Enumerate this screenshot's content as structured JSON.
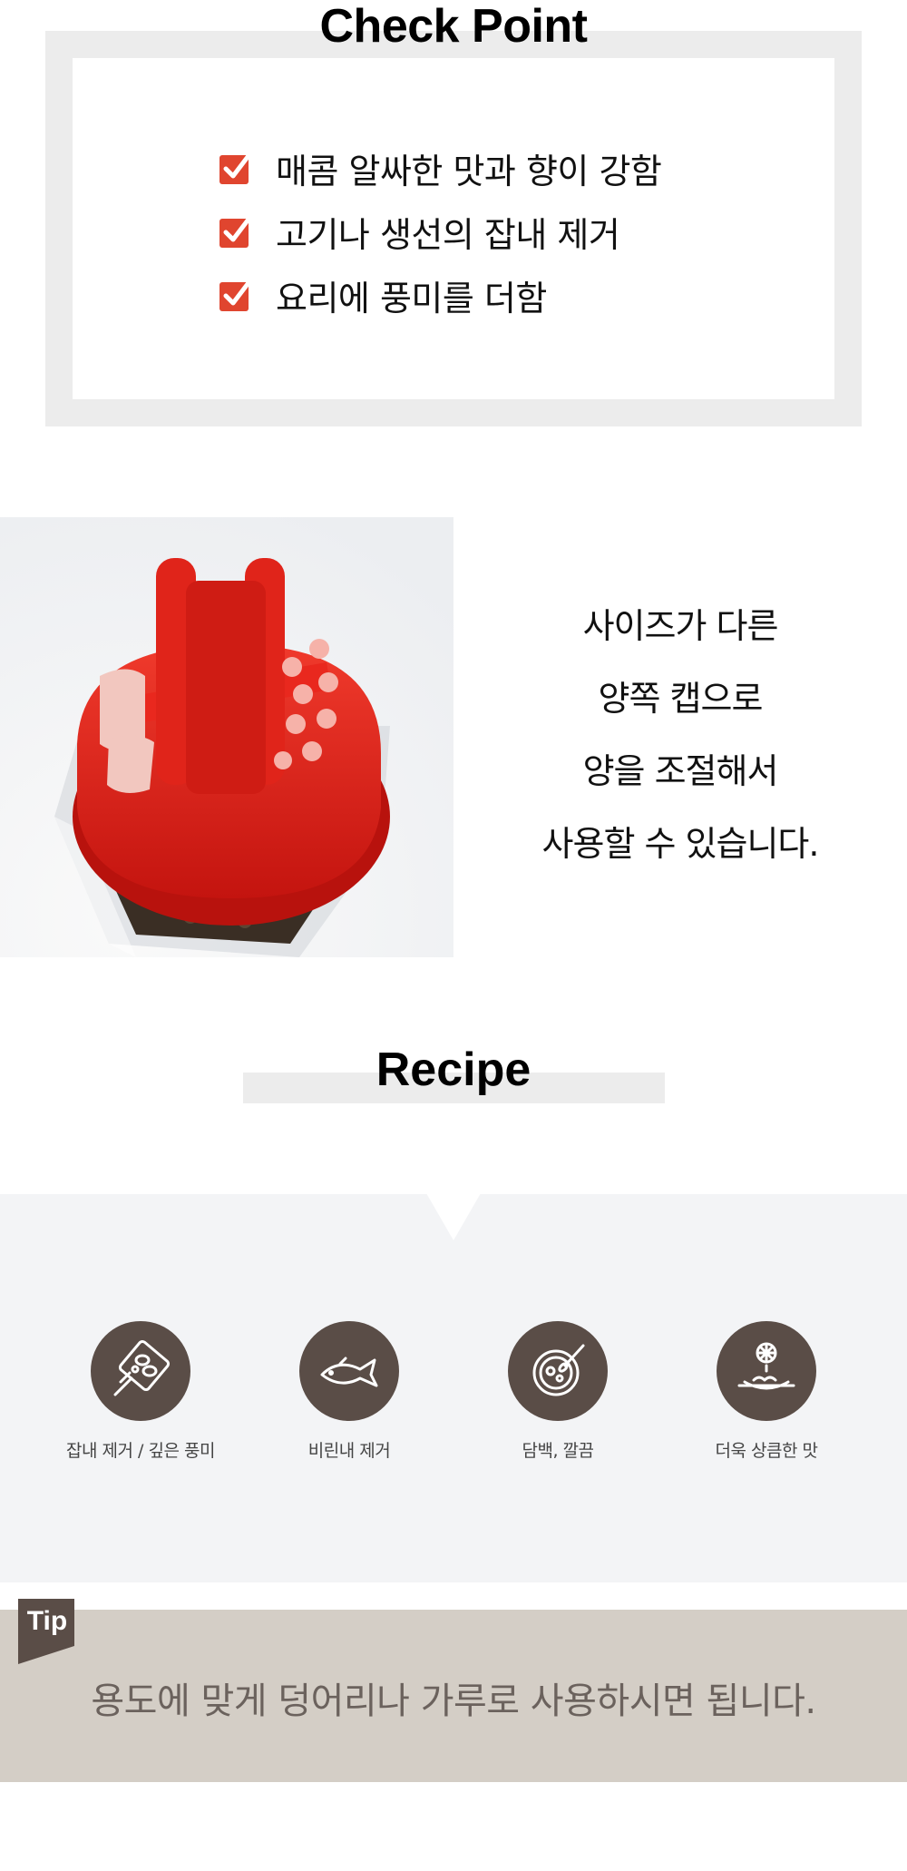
{
  "check_point": {
    "title": "Check Point",
    "items": [
      {
        "icon": "check-icon",
        "text": "매콤 알싸한 맛과 향이 강함"
      },
      {
        "icon": "check-icon",
        "text": "고기나 생선의 잡내 제거"
      },
      {
        "icon": "check-icon",
        "text": "요리에 풍미를 더함"
      }
    ]
  },
  "product": {
    "image": "red-shaker-cap-pepper-bottle",
    "lines": [
      "사이즈가 다른",
      "양쪽 캡으로",
      "양을 조절해서",
      "사용할 수 있습니다."
    ]
  },
  "recipe": {
    "title": "Recipe",
    "items": [
      {
        "icon": "grill-icon",
        "label": "잡내 제거 / 깊은 풍미"
      },
      {
        "icon": "fish-icon",
        "label": "비린내 제거"
      },
      {
        "icon": "soup-bowl-icon",
        "label": "담백, 깔끔"
      },
      {
        "icon": "lemon-dish-icon",
        "label": "더욱 상큼한 맛"
      }
    ]
  },
  "tip": {
    "badge": "Tip",
    "text": "용도에 맞게 덩어리나 가루로 사용하시면 됩니다."
  },
  "colors": {
    "check": "#e0452f",
    "cap_red": "#e4231d",
    "icon_circle": "#5a4d47",
    "tip_bg": "#d4cec6",
    "panel_bg": "#f3f4f6"
  }
}
